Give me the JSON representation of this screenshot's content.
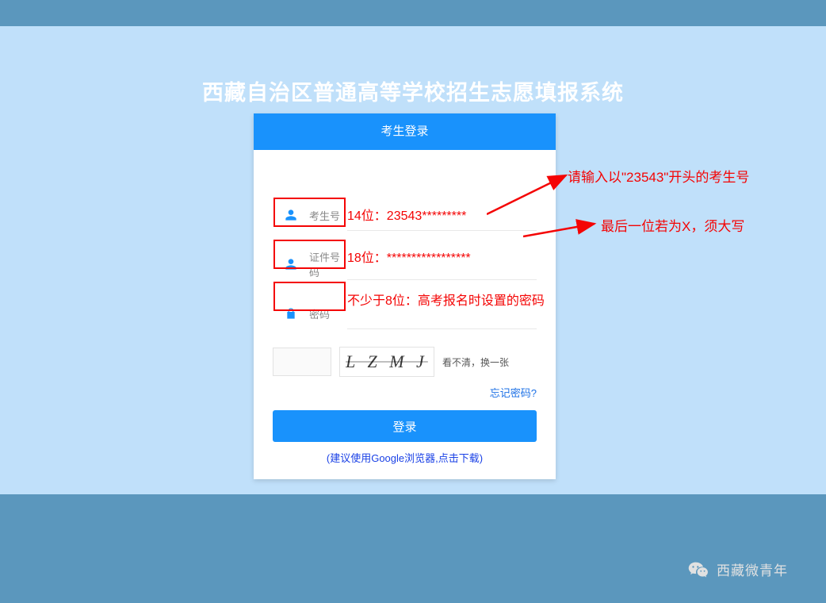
{
  "page": {
    "title": "西藏自治区普通高等学校招生志愿填报系统"
  },
  "card": {
    "header": "考生登录",
    "fields": {
      "exam_no_label": "考生号",
      "id_no_label": "证件号码",
      "password_label": "密码"
    },
    "captcha_text": "L Z M J",
    "captcha_refresh": "看不清，换一张",
    "forgot": "忘记密码?",
    "login_button": "登录",
    "footer_tip": "(建议使用Google浏览器,点击下载)"
  },
  "overlays": {
    "exam_no": "14位：23543*********",
    "id_no": "18位：*****************",
    "password": "不少于8位：高考报名时设置的密码"
  },
  "annotations": {
    "a1": "请输入以\"23543\"开头的考生号",
    "a2": "最后一位若为X，须大写"
  },
  "watermark": {
    "text": "西藏微青年"
  }
}
